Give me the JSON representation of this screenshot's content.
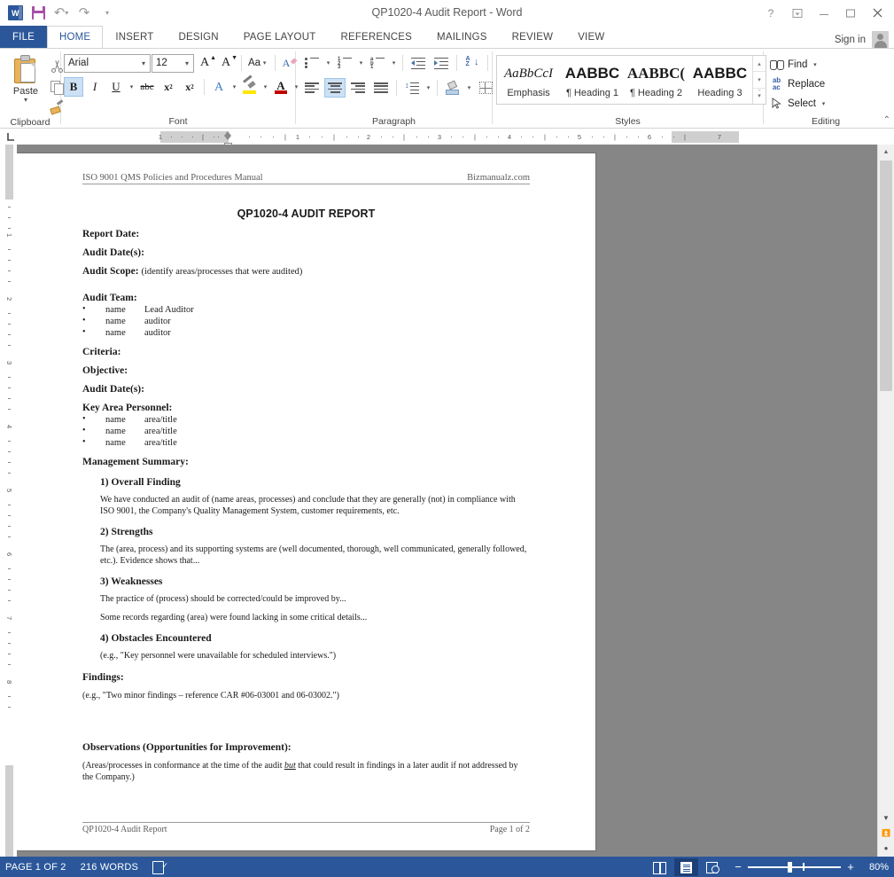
{
  "window": {
    "title": "QP1020-4 Audit Report - Word",
    "quick_access": [
      "word-logo",
      "save-icon",
      "undo-icon",
      "redo-icon",
      "customize-qat-icon"
    ],
    "controls": {
      "help": "?",
      "ribbon_display": "ribbon-options-icon",
      "minimize": "minimize-icon",
      "restore": "restore-icon",
      "close": "close-icon"
    }
  },
  "tabs": {
    "file": "FILE",
    "items": [
      "HOME",
      "INSERT",
      "DESIGN",
      "PAGE LAYOUT",
      "REFERENCES",
      "MAILINGS",
      "REVIEW",
      "VIEW"
    ],
    "active": "HOME",
    "sign_in": "Sign in"
  },
  "ribbon": {
    "clipboard": {
      "label": "Clipboard",
      "paste": "Paste",
      "paste_caret": "▾",
      "cut": "cut-icon",
      "copy": "copy-icon",
      "format_painter": "format-painter-icon"
    },
    "font": {
      "label": "Font",
      "font_name": "Arial",
      "font_size": "12",
      "caret": "▾",
      "grow_font": "A",
      "shrink_font": "A",
      "change_case": "Aa",
      "clear_formatting": "clear-formatting-icon",
      "bold": "B",
      "italic": "I",
      "underline": "U",
      "strikethrough": "abc",
      "subscript": "x",
      "subscript_sub": "2",
      "superscript": "x",
      "superscript_sup": "2",
      "text_effects": "A",
      "highlight": "highlight-icon",
      "font_color": "A"
    },
    "paragraph": {
      "label": "Paragraph",
      "bullets": "bullets-icon",
      "numbering": "numbering-icon",
      "multilevel": "multilevel-list-icon",
      "decrease_indent": "decrease-indent-icon",
      "increase_indent": "increase-indent-icon",
      "sort": "sort-icon",
      "sort_a": "A",
      "sort_z": "Z",
      "show_marks": "¶",
      "align_left": "align-left-icon",
      "align_center": "align-center-icon",
      "align_right": "align-right-icon",
      "justify": "justify-icon",
      "line_spacing": "line-spacing-icon",
      "shading": "shading-icon",
      "borders": "borders-icon"
    },
    "styles": {
      "label": "Styles",
      "items": [
        {
          "preview": "AaBbCcI",
          "name": "Emphasis",
          "style": "italic-serif"
        },
        {
          "preview": "AABBC",
          "name": "¶ Heading 1",
          "style": "bold-sans"
        },
        {
          "preview": "AABBC(",
          "name": "¶ Heading 2",
          "style": "bold-serif"
        },
        {
          "preview": "AABBC",
          "name": "Heading 3",
          "style": "bold-sans"
        }
      ],
      "scroll_up": "▴",
      "scroll_down": "▾",
      "more": "▾"
    },
    "editing": {
      "label": "Editing",
      "find": "Find",
      "find_caret": "▾",
      "replace": "Replace",
      "replace_icon": "ab ac",
      "select": "Select",
      "select_caret": "▾",
      "collapse_ribbon": "⌃"
    }
  },
  "ruler": {
    "tab_selector": "tab-left-icon",
    "horizontal_labels": [
      "1",
      "1",
      "2",
      "3",
      "4",
      "5",
      "6",
      "7"
    ],
    "vertical_labels": [
      "1",
      "2",
      "3",
      "4",
      "5",
      "6",
      "7",
      "8"
    ]
  },
  "document": {
    "header": {
      "left": "ISO 9001 QMS Policies and Procedures Manual",
      "right": "Bizmanualz.com"
    },
    "title": "QP1020-4 AUDIT REPORT",
    "fields": [
      {
        "label": "Report Date:",
        "hint": ""
      },
      {
        "label": "Audit Date(s):",
        "hint": ""
      },
      {
        "label": "Audit Scope:",
        "hint": "(identify areas/processes that were audited)"
      }
    ],
    "audit_team": {
      "label": "Audit Team:",
      "rows": [
        {
          "name": "name",
          "role": "Lead Auditor"
        },
        {
          "name": "name",
          "role": "auditor"
        },
        {
          "name": "name",
          "role": "auditor"
        }
      ]
    },
    "fields2": [
      {
        "label": "Criteria:"
      },
      {
        "label": "Objective:"
      },
      {
        "label": "Audit Date(s):"
      }
    ],
    "key_area_personnel": {
      "label": "Key Area Personnel:",
      "rows": [
        {
          "name": "name",
          "role": "area/title"
        },
        {
          "name": "name",
          "role": "area/title"
        },
        {
          "name": "name",
          "role": "area/title"
        }
      ]
    },
    "management_summary": {
      "label": "Management Summary:",
      "sections": [
        {
          "heading": "1) Overall Finding",
          "paragraphs": [
            "We have conducted an audit of (name areas, processes) and conclude that they are generally (not) in compliance with ISO 9001, the Company's Quality Management System, customer requirements, etc."
          ]
        },
        {
          "heading": "2) Strengths",
          "paragraphs": [
            "The (area, process) and its supporting systems are (well documented, thorough, well communicated, generally followed, etc.).  Evidence shows that..."
          ]
        },
        {
          "heading": "3) Weaknesses",
          "paragraphs": [
            "The practice of (process) should be corrected/could be improved by...",
            "Some records regarding (area) were found lacking in some critical details..."
          ]
        },
        {
          "heading": "4) Obstacles Encountered",
          "paragraphs": [
            "(e.g., \"Key personnel were unavailable for scheduled interviews.\")"
          ]
        }
      ]
    },
    "findings": {
      "label": "Findings:",
      "text": "(e.g., \"Two minor findings – reference CAR #06-03001 and 06-03002.\")"
    },
    "observations": {
      "label": "Observations (Opportunities for Improvement):",
      "text_before": "(Areas/processes in conformance at the time of the audit ",
      "emphasis": "but",
      "text_after": " that could result in findings in a later audit if not addressed by the Company.)"
    },
    "footer": {
      "left": "QP1020-4 Audit Report",
      "right": "Page 1 of 2"
    }
  },
  "status_bar": {
    "page": "PAGE 1 OF 2",
    "words": "216 WORDS",
    "proofing": "proofing-errors-icon",
    "views": {
      "read_mode": "read-mode-icon",
      "print_layout": "print-layout-icon",
      "web_layout": "web-layout-icon",
      "active": "print_layout"
    },
    "zoom": {
      "minus": "−",
      "plus": "+",
      "value": "80%"
    }
  },
  "colors": {
    "accent": "#2b579a",
    "ribbon_bg": "#ffffff",
    "workspace_bg": "#868686",
    "page_bg": "#ffffff",
    "selected_tool": "#cde1f5"
  }
}
